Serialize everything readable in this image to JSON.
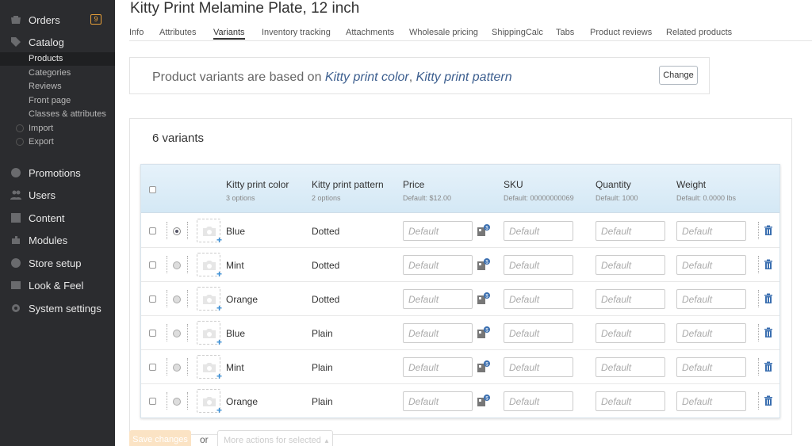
{
  "sidebar": {
    "items": [
      {
        "label": "Orders",
        "icon": "orders-icon",
        "badge": "9"
      },
      {
        "label": "Catalog",
        "icon": "catalog-icon"
      },
      {
        "label": "Promotions",
        "icon": "promotions-icon"
      },
      {
        "label": "Users",
        "icon": "users-icon"
      },
      {
        "label": "Content",
        "icon": "content-icon"
      },
      {
        "label": "Modules",
        "icon": "modules-icon"
      },
      {
        "label": "Store setup",
        "icon": "store-setup-icon"
      },
      {
        "label": "Look & Feel",
        "icon": "look-feel-icon"
      },
      {
        "label": "System settings",
        "icon": "system-settings-icon"
      }
    ],
    "catalog_sub": [
      "Products",
      "Categories",
      "Reviews",
      "Front page",
      "Classes & attributes",
      "Import",
      "Export"
    ]
  },
  "header": {
    "title": "Kitty Print Melamine Plate, 12 inch",
    "tabs": [
      "Info",
      "Attributes",
      "Variants",
      "Inventory tracking",
      "Attachments",
      "Wholesale pricing",
      "ShippingCalc",
      "Tabs",
      "Product reviews",
      "Related products"
    ],
    "active_tab": "Variants"
  },
  "based_on": {
    "prefix": "Product variants are based on",
    "attr1": "Kitty print color",
    "separator": ",",
    "attr2": "Kitty print pattern",
    "change_label": "Change"
  },
  "variants": {
    "count_label": "6 variants",
    "columns": [
      {
        "label": "Kitty print color",
        "sub": "3 options"
      },
      {
        "label": "Kitty print pattern",
        "sub": "2 options"
      },
      {
        "label": "Price",
        "sub": "Default: $12.00"
      },
      {
        "label": "SKU",
        "sub": "Default: 00000000069"
      },
      {
        "label": "Quantity",
        "sub": "Default: 1000"
      },
      {
        "label": "Weight",
        "sub": "Default: 0.0000 lbs"
      }
    ],
    "placeholder": "Default",
    "rows": [
      {
        "color": "Blue",
        "pattern": "Dotted",
        "default": true
      },
      {
        "color": "Mint",
        "pattern": "Dotted",
        "default": false
      },
      {
        "color": "Orange",
        "pattern": "Dotted",
        "default": false
      },
      {
        "color": "Blue",
        "pattern": "Plain",
        "default": false
      },
      {
        "color": "Mint",
        "pattern": "Plain",
        "default": false
      },
      {
        "color": "Orange",
        "pattern": "Plain",
        "default": false
      }
    ]
  },
  "footer": {
    "save_label": "Save changes",
    "or_label": "or",
    "more_actions_label": "More actions for selected"
  },
  "colors": {
    "sidebar_bg": "#2b2c2f",
    "accent_link": "#3d5f8f",
    "badge": "#e8a03a",
    "table_header": "#dcecf7"
  }
}
